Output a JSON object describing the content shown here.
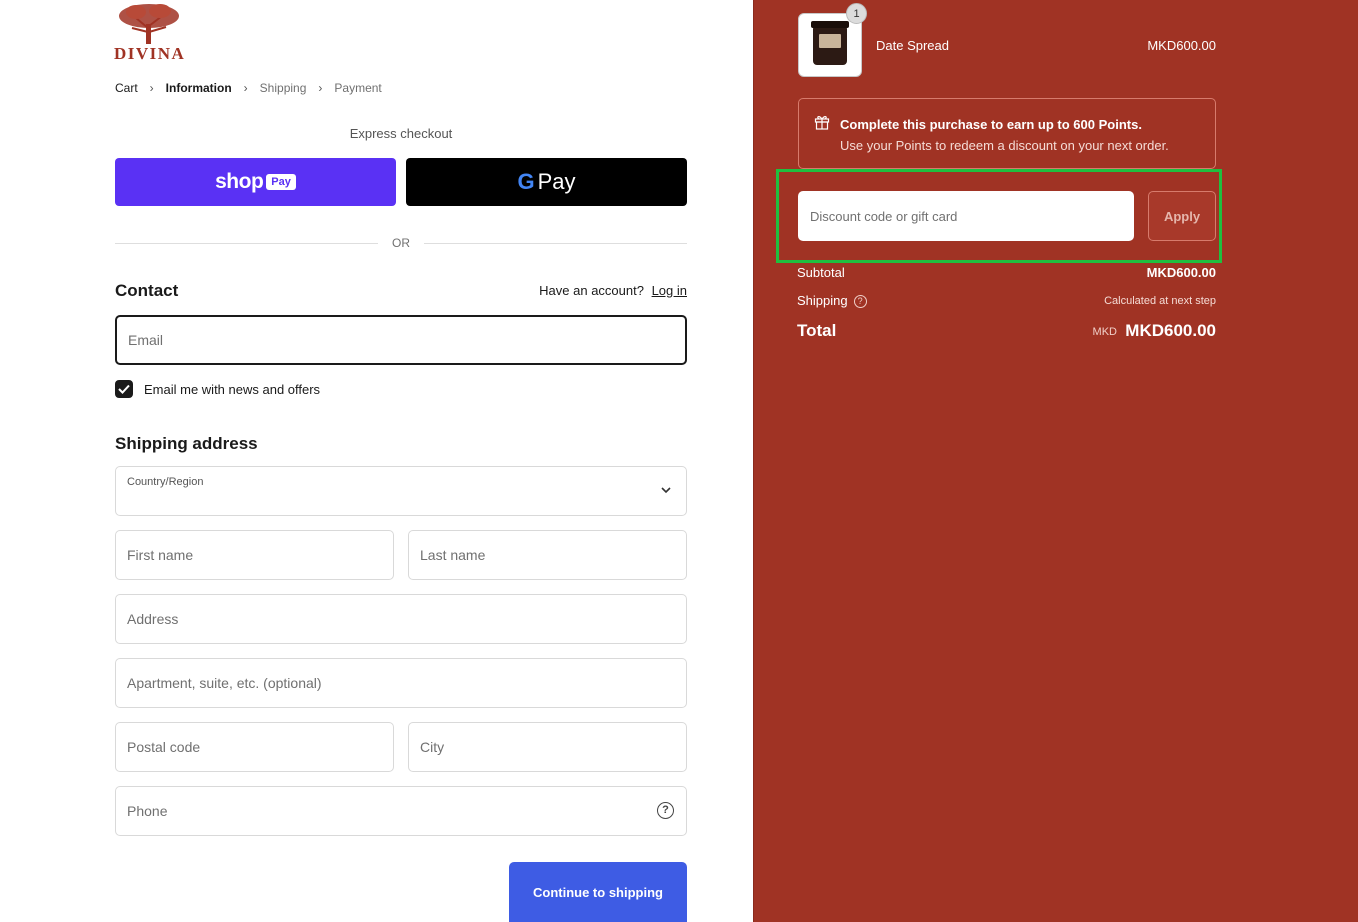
{
  "brand": {
    "logo_text": "DIVINA"
  },
  "breadcrumb": [
    {
      "label": "Cart"
    },
    {
      "label": "Information"
    },
    {
      "label": "Shipping"
    },
    {
      "label": "Payment"
    }
  ],
  "express": {
    "label": "Express checkout",
    "shop_pay_word": "shop",
    "shop_pay_box": "Pay",
    "g_pay_g": "G",
    "g_pay_word": "Pay",
    "divider": "OR"
  },
  "contact": {
    "title": "Contact",
    "have_account": "Have an account?",
    "login": "Log in",
    "email_placeholder": "Email",
    "newsletter_label": "Email me with news and offers",
    "newsletter_checked": true
  },
  "shipping": {
    "title": "Shipping address",
    "country_label": "Country/Region",
    "country_value": "",
    "first_name_placeholder": "First name",
    "last_name_placeholder": "Last name",
    "address_placeholder": "Address",
    "apartment_placeholder": "Apartment, suite, etc. (optional)",
    "postal_placeholder": "Postal code",
    "city_placeholder": "City",
    "phone_placeholder": "Phone",
    "continue_label": "Continue to shipping"
  },
  "order": {
    "item_name": "Date Spread",
    "item_price": "MKD600.00",
    "item_qty": "1",
    "points_title": "Complete this purchase to earn up to 600 Points.",
    "points_sub": "Use your Points to redeem a discount on your next order.",
    "discount_placeholder": "Discount code or gift card",
    "apply_label": "Apply",
    "subtotal_label": "Subtotal",
    "subtotal_value": "MKD600.00",
    "shipping_label": "Shipping",
    "shipping_value": "Calculated at next step",
    "total_label": "Total",
    "total_currency": "MKD",
    "total_value": "MKD600.00"
  },
  "colors": {
    "sidebar_bg": "#a03324",
    "shop_pay": "#5a31f4",
    "continue_button": "#3e5ce4",
    "highlight_border": "#1fbf3f"
  }
}
